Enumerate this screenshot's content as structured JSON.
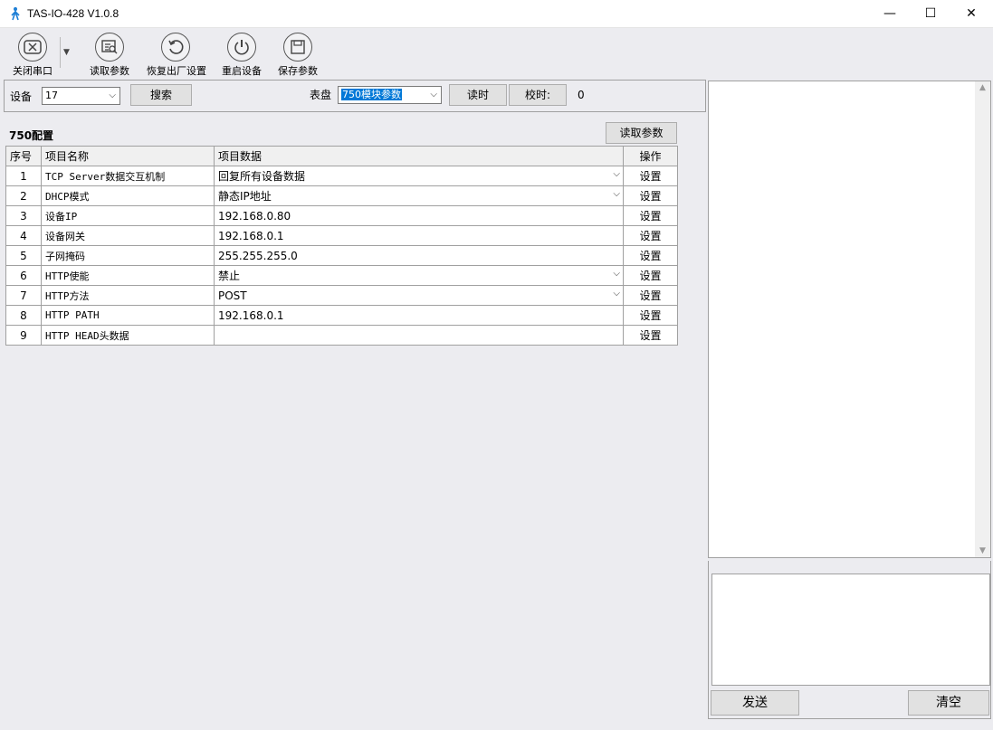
{
  "window": {
    "title": "TAS-IO-428 V1.0.8",
    "min_glyph": "—",
    "max_glyph": "☐",
    "close_glyph": "✕"
  },
  "toolbar": {
    "close_port": "关闭串口",
    "read_params": "读取参数",
    "restore_factory": "恢复出厂设置",
    "restart_device": "重启设备",
    "save_params": "保存参数"
  },
  "device_bar": {
    "device_label": "设备",
    "device_value": "17",
    "search_button": "搜索",
    "table_label": "表盘",
    "table_value": "750模块参数",
    "read_time_button": "读时",
    "calibrate_time_button": "校时:",
    "time_value": "0"
  },
  "config": {
    "section_title": "750配置",
    "read_params_button": "读取参数",
    "columns": [
      "序号",
      "项目名称",
      "项目数据",
      "操作"
    ],
    "rows": [
      {
        "no": "1",
        "name": "TCP Server数据交互机制",
        "value": "回复所有设备数据",
        "dropdown": true,
        "action": "设置"
      },
      {
        "no": "2",
        "name": "DHCP模式",
        "value": "静态IP地址",
        "dropdown": true,
        "action": "设置"
      },
      {
        "no": "3",
        "name": "设备IP",
        "value": "192.168.0.80",
        "dropdown": false,
        "action": "设置"
      },
      {
        "no": "4",
        "name": "设备网关",
        "value": "192.168.0.1",
        "dropdown": false,
        "action": "设置"
      },
      {
        "no": "5",
        "name": "子网掩码",
        "value": "255.255.255.0",
        "dropdown": false,
        "action": "设置"
      },
      {
        "no": "6",
        "name": "HTTP使能",
        "value": "禁止",
        "dropdown": true,
        "action": "设置"
      },
      {
        "no": "7",
        "name": "HTTP方法",
        "value": "POST",
        "dropdown": true,
        "action": "设置"
      },
      {
        "no": "8",
        "name": "HTTP PATH",
        "value": "192.168.0.1",
        "dropdown": false,
        "action": "设置"
      },
      {
        "no": "9",
        "name": "HTTP HEAD头数据",
        "value": "",
        "dropdown": false,
        "action": "设置"
      }
    ]
  },
  "right": {
    "send_button": "发送",
    "clear_button": "清空"
  },
  "colors": {
    "accent": "#0078d7",
    "background": "#ececf0"
  }
}
